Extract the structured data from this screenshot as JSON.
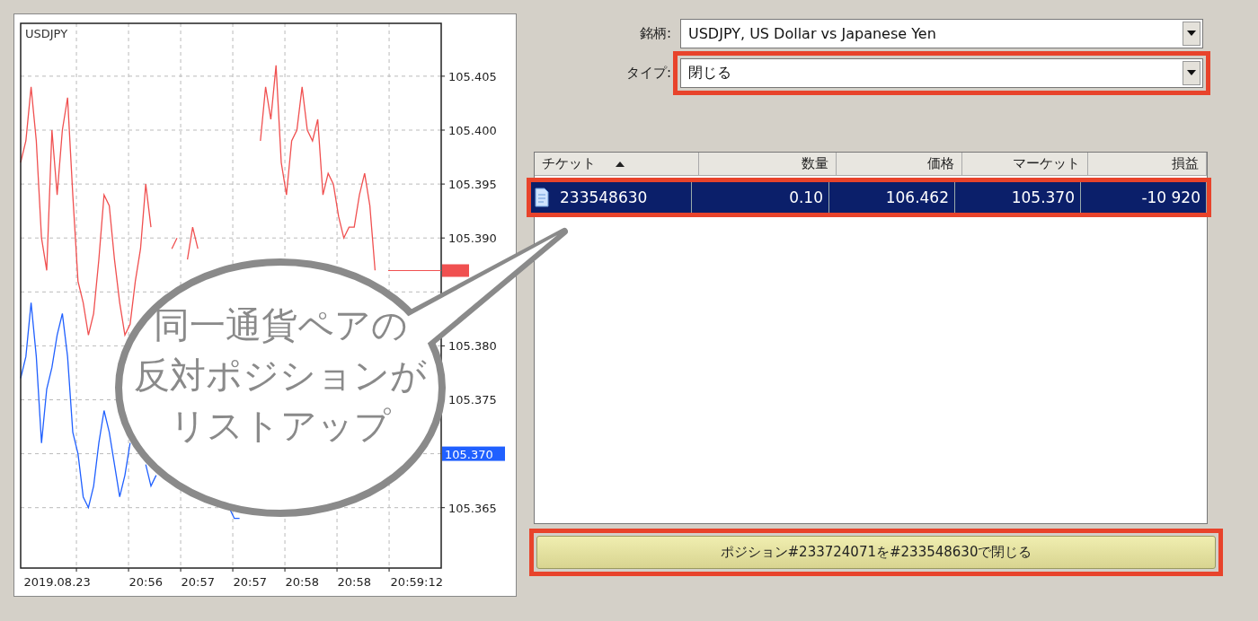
{
  "chart": {
    "chart_data": {
      "type": "line",
      "title": "USDJPY",
      "grid": true,
      "categories": [
        null,
        null,
        null,
        null,
        null,
        null,
        null,
        "2019.08.23",
        null,
        null,
        null,
        null,
        null,
        null,
        null,
        null,
        null,
        null,
        null,
        null,
        null,
        null,
        null,
        null,
        "20:56",
        null,
        null,
        null,
        null,
        null,
        null,
        null,
        null,
        null,
        "20:57",
        null,
        null,
        null,
        null,
        null,
        null,
        null,
        null,
        null,
        "20:57",
        null,
        null,
        null,
        null,
        null,
        null,
        null,
        null,
        null,
        "20:58",
        null,
        null,
        null,
        null,
        null,
        null,
        null,
        null,
        null,
        "20:58",
        null,
        null,
        null,
        null,
        null,
        null,
        null,
        null,
        null,
        null,
        null,
        "20:59:12",
        null,
        null,
        null,
        null
      ],
      "ylim": [
        105.3594,
        105.4099
      ],
      "yticks": [
        {
          "value": 105.365,
          "label": "105.365"
        },
        {
          "value": 105.375,
          "label": "105.375"
        },
        {
          "value": 105.38,
          "label": "105.380"
        },
        {
          "value": 105.39,
          "label": "105.390"
        },
        {
          "value": 105.395,
          "label": "105.395"
        },
        {
          "value": 105.4,
          "label": "105.400"
        },
        {
          "value": 105.405,
          "label": "105.405"
        }
      ],
      "series": [
        {
          "color": "#f05050",
          "values": [
            105.397,
            105.399,
            105.404,
            105.399,
            105.39,
            105.387,
            105.4,
            105.394,
            105.4,
            105.403,
            105.394,
            105.386,
            105.384,
            105.381,
            105.383,
            105.388,
            105.394,
            105.393,
            105.388,
            105.384,
            105.381,
            105.382,
            105.386,
            105.389,
            105.395,
            105.391,
            null,
            null,
            null,
            105.389,
            105.39,
            null,
            105.388,
            105.391,
            105.389,
            null,
            null,
            null,
            null,
            null,
            null,
            null,
            null,
            null,
            null,
            null,
            105.399,
            105.404,
            105.401,
            105.406,
            105.397,
            105.394,
            105.399,
            105.4,
            105.404,
            105.4,
            105.399,
            105.401,
            105.394,
            105.396,
            105.395,
            105.392,
            105.39,
            105.391,
            105.391,
            105.394,
            105.396,
            105.393,
            105.387,
            null,
            null,
            null,
            null,
            null,
            null,
            null,
            null,
            null,
            null,
            null,
            null
          ]
        },
        {
          "color": "#2060ff",
          "values": [
            105.377,
            105.379,
            105.384,
            105.379,
            105.371,
            105.376,
            105.378,
            105.381,
            105.383,
            105.379,
            105.372,
            105.37,
            105.366,
            105.365,
            105.367,
            105.371,
            105.374,
            105.372,
            105.369,
            105.366,
            105.368,
            105.371,
            null,
            null,
            105.369,
            105.367,
            105.368,
            null,
            null,
            null,
            null,
            null,
            null,
            null,
            null,
            null,
            null,
            null,
            null,
            null,
            105.365,
            105.364,
            105.364,
            null,
            null,
            null,
            null,
            null,
            null,
            null,
            null,
            null,
            null,
            null,
            null,
            null,
            null,
            null,
            null,
            null,
            null,
            null,
            null,
            null,
            null,
            null,
            null,
            null,
            null,
            null,
            null,
            null,
            null,
            null,
            null,
            null,
            null,
            null,
            null,
            null,
            null
          ]
        }
      ]
    },
    "markers": [
      {
        "kind": "ask",
        "color": "#f05050"
      },
      {
        "kind": "bid",
        "label": "105.370",
        "color": "#2060ff"
      }
    ]
  },
  "form": {
    "symbol": {
      "label": "銘柄:",
      "value": "USDJPY, US Dollar vs Japanese Yen",
      "highlighted": false
    },
    "type": {
      "label": "タイプ:",
      "value": "閉じる",
      "highlighted": true
    }
  },
  "table": {
    "columns": [
      {
        "label": "チケット",
        "sorted": true
      },
      {
        "label": "数量",
        "sorted": false
      },
      {
        "label": "価格",
        "sorted": false
      },
      {
        "label": "マーケット",
        "sorted": false
      },
      {
        "label": "損益",
        "sorted": false
      }
    ],
    "rows": [
      {
        "cells": [
          "233548630",
          "0.10",
          "106.462",
          "105.370",
          "-10 920"
        ],
        "selected": true,
        "highlighted": true
      }
    ]
  },
  "close_button": {
    "label": "ポジション#233724071を#233548630で閉じる",
    "highlighted": true
  },
  "callout": {
    "lines": [
      "同一通貨ペアの",
      "反対ポジションが",
      "リストアップ"
    ]
  }
}
